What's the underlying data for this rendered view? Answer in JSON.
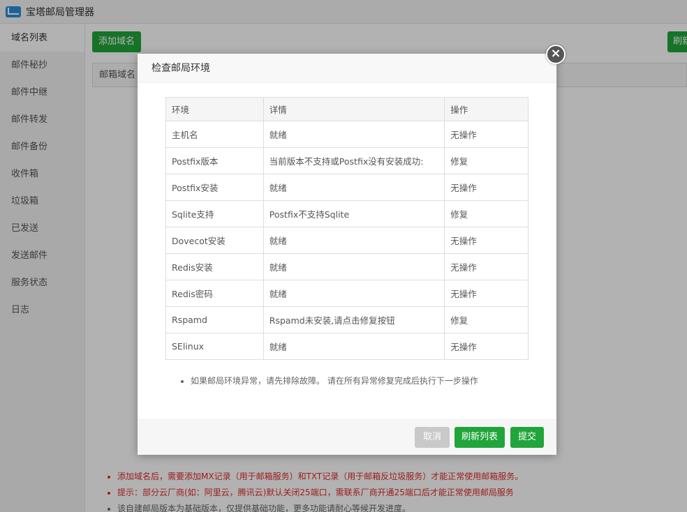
{
  "app": {
    "title": "宝塔邮局管理器"
  },
  "sidebar": {
    "items": [
      {
        "label": "域名列表"
      },
      {
        "label": "邮件秘抄"
      },
      {
        "label": "邮件中继"
      },
      {
        "label": "邮件转发"
      },
      {
        "label": "邮件备份"
      },
      {
        "label": "收件箱"
      },
      {
        "label": "垃圾箱"
      },
      {
        "label": "已发送"
      },
      {
        "label": "发送邮件"
      },
      {
        "label": "服务状态"
      },
      {
        "label": "日志"
      }
    ]
  },
  "main": {
    "add_domain_label": "添加域名",
    "refresh_label": "刷新",
    "table_header_first": "邮箱域名",
    "notes": [
      "添加域名后，需要添加MX记录（用于邮箱服务）和TXT记录（用于邮箱反垃圾服务）才能正常使用邮箱服务。",
      "提示：部分云厂商(如：阿里云，腾讯云)默认关闭25端口，需联系厂商开通25端口后才能正常使用邮局服务",
      "该自建邮局版本为基础版本，仅提供基础功能，更多功能请耐心等候开发进度。"
    ]
  },
  "modal": {
    "title": "检查邮局环境",
    "close_symbol": "×",
    "columns": [
      "环境",
      "详情",
      "操作"
    ],
    "rows": [
      {
        "env": "主机名",
        "detail": "就绪",
        "status": "ok",
        "action": "无操作"
      },
      {
        "env": "Postfix版本",
        "detail": "当前版本不支持或Postfix没有安装成功:",
        "status": "error",
        "action": "修复"
      },
      {
        "env": "Postfix安装",
        "detail": "就绪",
        "status": "ok",
        "action": "无操作"
      },
      {
        "env": "Sqlite支持",
        "detail": "Postfix不支持Sqlite",
        "status": "error",
        "action": "修复"
      },
      {
        "env": "Dovecot安装",
        "detail": "就绪",
        "status": "ok",
        "action": "无操作"
      },
      {
        "env": "Redis安装",
        "detail": "就绪",
        "status": "ok",
        "action": "无操作"
      },
      {
        "env": "Redis密码",
        "detail": "就绪",
        "status": "ok",
        "action": "无操作"
      },
      {
        "env": "Rspamd",
        "detail": "Rspamd未安装,请点击修复按钮",
        "status": "error",
        "action": "修复"
      },
      {
        "env": "SElinux",
        "detail": "就绪",
        "status": "ok",
        "action": "无操作"
      }
    ],
    "tip": "如果邮局环境异常，请先排除故障。 请在所有异常修复完成后执行下一步操作",
    "buttons": {
      "cancel": "取消",
      "refresh": "刷新列表",
      "submit": "提交"
    }
  },
  "colors": {
    "accent_green": "#20a53a",
    "error_red": "#e12a2a",
    "overlay": "rgba(0,0,0,0.3)"
  }
}
